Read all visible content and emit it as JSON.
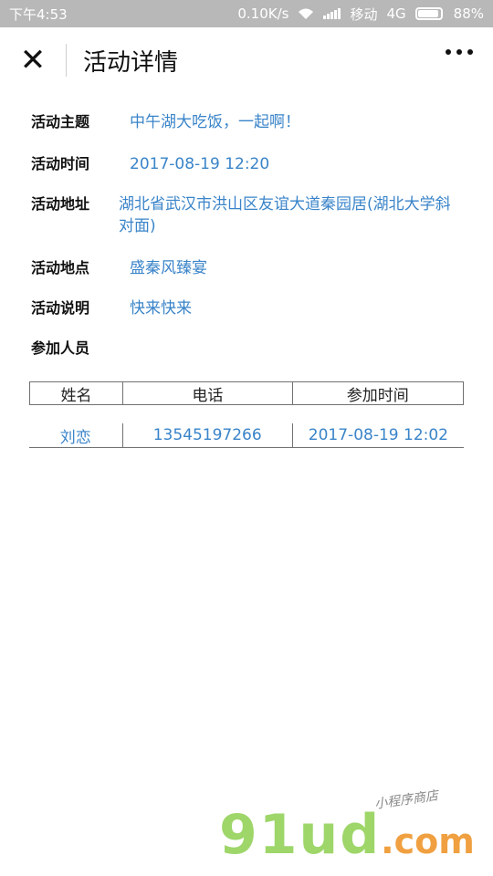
{
  "status_bar": {
    "time": "下午4:53",
    "speed": "0.10K/s",
    "carrier": "移动",
    "network": "4G",
    "battery": "88%"
  },
  "nav": {
    "close_icon": "✕",
    "title": "活动详情"
  },
  "details": [
    {
      "label": "活动主题",
      "value": "中午湖大吃饭，一起啊！"
    },
    {
      "label": "活动时间",
      "value": "2017-08-19 12:20"
    },
    {
      "label": "活动地址",
      "value": "湖北省武汉市洪山区友谊大道秦园居(湖北大学斜对面)"
    },
    {
      "label": "活动地点",
      "value": "盛秦风臻宴"
    },
    {
      "label": "活动说明",
      "value": "快来快来"
    },
    {
      "label": "参加人员",
      "value": ""
    }
  ],
  "table": {
    "headers": [
      "姓名",
      "电话",
      "参加时间"
    ],
    "rows": [
      [
        "刘恋",
        "13545197266",
        "2017-08-19 12:02"
      ]
    ]
  },
  "watermark": {
    "main": "91ud",
    "dotcom": ".com",
    "tag": "小程序商店"
  }
}
